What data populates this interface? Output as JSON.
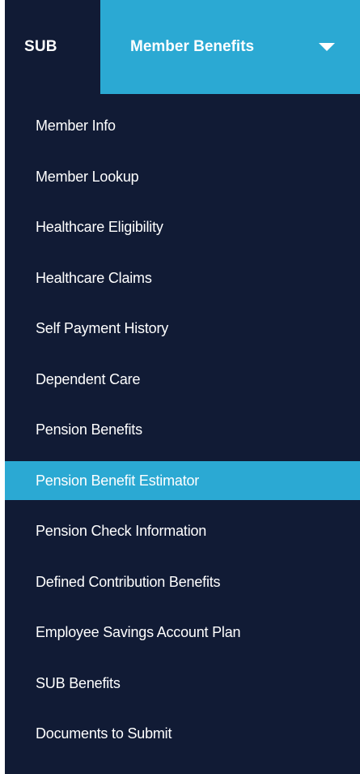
{
  "header": {
    "sub_label": "SUB",
    "benefits_label": "Member Benefits"
  },
  "menu": {
    "items": [
      {
        "label": "Member Info"
      },
      {
        "label": "Member Lookup"
      },
      {
        "label": "Healthcare Eligibility"
      },
      {
        "label": "Healthcare Claims"
      },
      {
        "label": "Self Payment History"
      },
      {
        "label": "Dependent Care"
      },
      {
        "label": "Pension Benefits"
      },
      {
        "label": "Pension Benefit Estimator"
      },
      {
        "label": "Pension Check Information"
      },
      {
        "label": "Defined Contribution Benefits"
      },
      {
        "label": "Employee Savings Account Plan"
      },
      {
        "label": "SUB Benefits"
      },
      {
        "label": "Documents to Submit"
      }
    ],
    "active_item": "Pension Benefit Estimator"
  },
  "colors": {
    "background": "#111b35",
    "accent": "#2ba9d3",
    "text": "#ffffff"
  }
}
